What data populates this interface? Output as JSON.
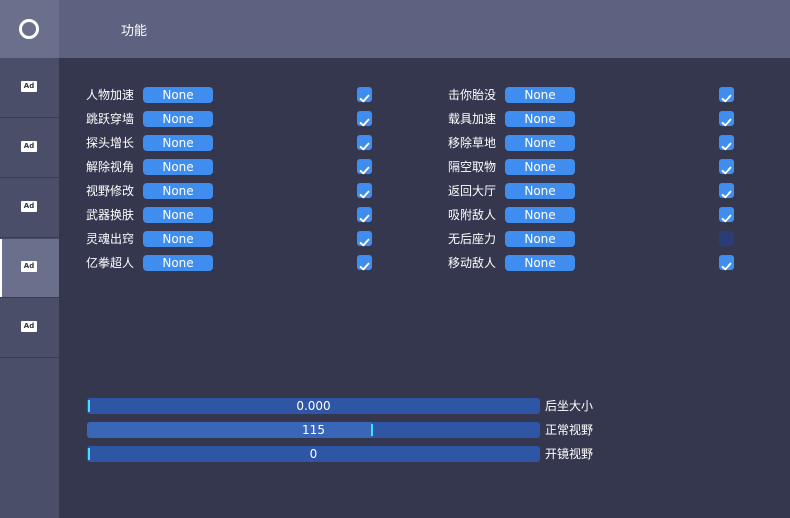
{
  "header": {
    "title": "功能"
  },
  "sidebar": {
    "logo": "ring-logo",
    "items": [
      {
        "label": "Ad",
        "active": false
      },
      {
        "label": "Ad",
        "active": false
      },
      {
        "label": "Ad",
        "active": false
      },
      {
        "label": "Ad",
        "active": true
      },
      {
        "label": "Ad",
        "active": false
      }
    ]
  },
  "features_left": [
    {
      "label": "人物加速",
      "key": "None",
      "checked": true
    },
    {
      "label": "跳跃穿墙",
      "key": "None",
      "checked": true
    },
    {
      "label": "探头增长",
      "key": "None",
      "checked": true
    },
    {
      "label": "解除视角",
      "key": "None",
      "checked": true
    },
    {
      "label": "视野修改",
      "key": "None",
      "checked": true
    },
    {
      "label": "武器换肤",
      "key": "None",
      "checked": true
    },
    {
      "label": "灵魂出窍",
      "key": "None",
      "checked": true
    },
    {
      "label": "亿拳超人",
      "key": "None",
      "checked": true
    }
  ],
  "features_right": [
    {
      "label": "击你胎没",
      "key": "None",
      "checked": true
    },
    {
      "label": "载具加速",
      "key": "None",
      "checked": true
    },
    {
      "label": "移除草地",
      "key": "None",
      "checked": true
    },
    {
      "label": "隔空取物",
      "key": "None",
      "checked": true
    },
    {
      "label": "返回大厅",
      "key": "None",
      "checked": true
    },
    {
      "label": "吸附敌人",
      "key": "None",
      "checked": true
    },
    {
      "label": "无后座力",
      "key": "None",
      "checked": false
    },
    {
      "label": "移动敌人",
      "key": "None",
      "checked": true
    }
  ],
  "sliders": [
    {
      "label": "后坐大小",
      "value": "0.000",
      "level": 0.0
    },
    {
      "label": "正常视野",
      "value": "115",
      "level": 0.63
    },
    {
      "label": "开镜视野",
      "value": "0",
      "level": 0.0
    }
  ],
  "colors": {
    "accent": "#3f8eef",
    "panel": "#34374d",
    "sidebar": "#4a4e68",
    "topbar": "#5d6280",
    "slider_track": "#2f56a5",
    "slider_thumb": "#3ee0ff"
  }
}
